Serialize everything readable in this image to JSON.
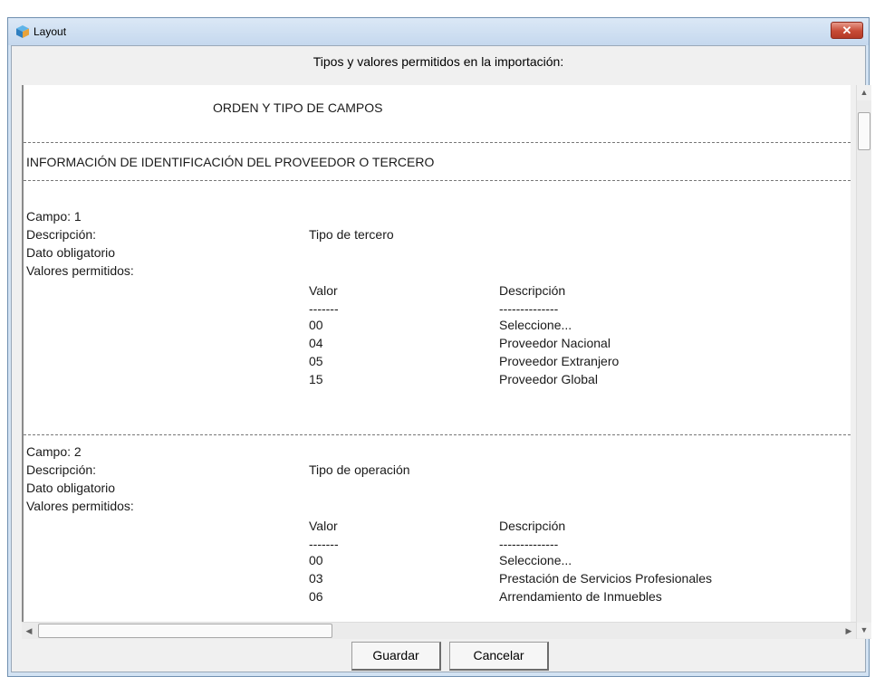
{
  "window": {
    "title": "Layout",
    "close_symbol": "✕"
  },
  "header": {
    "label": "Tipos y valores permitidos en la importación:"
  },
  "document": {
    "section_title": "ORDEN Y TIPO DE CAMPOS",
    "subsection_title": "INFORMACIÓN DE IDENTIFICACIÓN DEL PROVEEDOR O TERCERO",
    "fields": [
      {
        "campo": "Campo: 1",
        "descripcion_label": "Descripción:",
        "descripcion": "Tipo de tercero",
        "obligatorio": "Dato obligatorio",
        "valores_label": "Valores permitidos:",
        "col_valor": "Valor",
        "col_descripcion": "Descripción",
        "sep_valor": "-------",
        "sep_descripcion": "--------------",
        "rows": [
          {
            "valor": "00",
            "desc": "Seleccione..."
          },
          {
            "valor": "04",
            "desc": "Proveedor Nacional"
          },
          {
            "valor": "05",
            "desc": "Proveedor Extranjero"
          },
          {
            "valor": "15",
            "desc": "Proveedor Global"
          }
        ]
      },
      {
        "campo": "Campo: 2",
        "descripcion_label": "Descripción:",
        "descripcion": "Tipo de operación",
        "obligatorio": "Dato obligatorio",
        "valores_label": "Valores permitidos:",
        "col_valor": "Valor",
        "col_descripcion": "Descripción",
        "sep_valor": "-------",
        "sep_descripcion": "--------------",
        "rows": [
          {
            "valor": "00",
            "desc": "Seleccione..."
          },
          {
            "valor": "03",
            "desc": "Prestación de Servicios Profesionales"
          },
          {
            "valor": "06",
            "desc": "Arrendamiento de Inmuebles"
          }
        ]
      }
    ]
  },
  "buttons": {
    "save": "Guardar",
    "cancel": "Cancelar"
  }
}
